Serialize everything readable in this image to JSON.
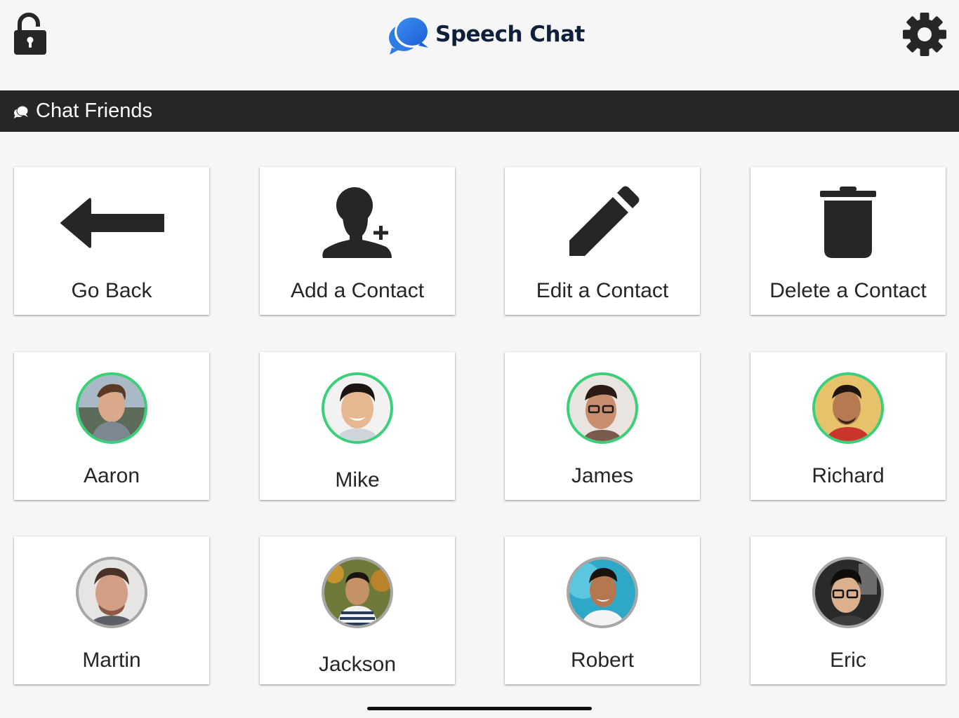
{
  "app": {
    "title": "Speech Chat"
  },
  "section": {
    "title": "Chat Friends"
  },
  "actions": [
    {
      "label": "Go Back",
      "icon": "arrow-left-icon"
    },
    {
      "label": "Add a Contact",
      "icon": "add-person-icon"
    },
    {
      "label": "Edit a Contact",
      "icon": "pencil-icon"
    },
    {
      "label": "Delete a Contact",
      "icon": "trash-icon"
    }
  ],
  "contacts": [
    {
      "name": "Aaron",
      "status": "online"
    },
    {
      "name": "Mike",
      "status": "online"
    },
    {
      "name": "James",
      "status": "online"
    },
    {
      "name": "Richard",
      "status": "online"
    },
    {
      "name": "Martin",
      "status": "offline"
    },
    {
      "name": "Jackson",
      "status": "offline"
    },
    {
      "name": "Robert",
      "status": "offline"
    },
    {
      "name": "Eric",
      "status": "offline"
    }
  ],
  "colors": {
    "online_ring": "#3ad07a",
    "offline_ring": "#a7a7a7",
    "section_bar": "#262626",
    "brand_blue": "#1f6fe5",
    "logo_text": "#10203a"
  }
}
